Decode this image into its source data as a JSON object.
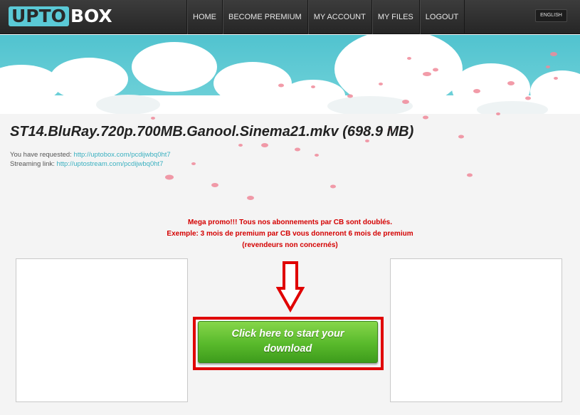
{
  "header": {
    "logo": {
      "part1": "UPTO",
      "part2": "BOX"
    },
    "nav": [
      {
        "label": "HOME"
      },
      {
        "label": "BECOME PREMIUM"
      },
      {
        "label": "MY ACCOUNT"
      },
      {
        "label": "MY FILES"
      },
      {
        "label": "LOGOUT"
      }
    ],
    "language": "ENGLISH"
  },
  "file": {
    "title": "ST14.BluRay.720p.700MB.Ganool.Sinema21.mkv (698.9 MB)",
    "requested_label": "You have requested:",
    "requested_link": "http://uptobox.com/pcdijwbq0ht7",
    "streaming_label": "Streaming link:",
    "streaming_link": "http://uptostream.com/pcdijwbq0ht7"
  },
  "promo": {
    "line1": "Mega promo!!! Tous nos abonnements par CB sont doublés.",
    "line2": "Exemple: 3 mois de premium par CB vous donneront 6 mois de premium",
    "line3": "(revendeurs non concernés)"
  },
  "download": {
    "label_line1": "Click here to start your",
    "label_line2": "download"
  },
  "colors": {
    "accent": "#5ac9d6",
    "promo_red": "#d40000",
    "button_green": "#58b92b",
    "highlight_red": "#e00000"
  },
  "icons": {
    "arrow": "arrow-down-outline-icon"
  }
}
